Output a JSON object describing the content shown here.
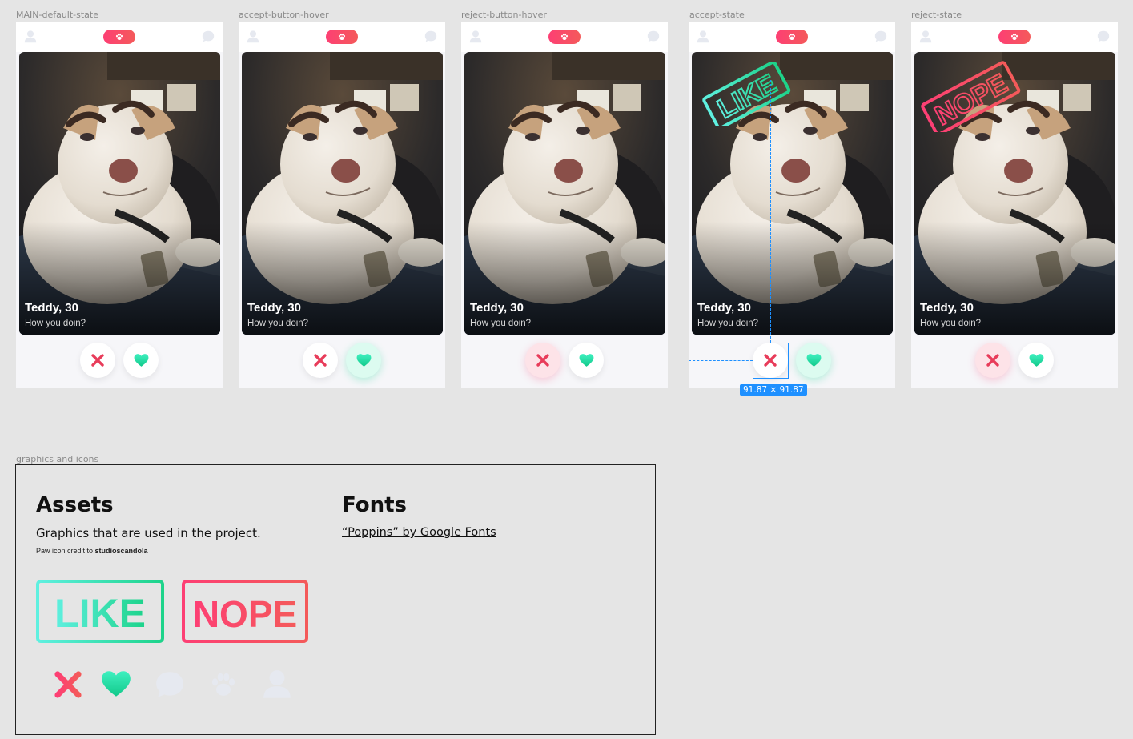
{
  "frames": [
    {
      "label": "MAIN-default-state",
      "state": "default"
    },
    {
      "label": "accept-button-hover",
      "state": "accept-hover"
    },
    {
      "label": "reject-button-hover",
      "state": "reject-hover"
    },
    {
      "label": "accept-state",
      "state": "accept"
    },
    {
      "label": "reject-state",
      "state": "reject"
    }
  ],
  "card": {
    "name": "Teddy, 30",
    "tagline": "How you doin?"
  },
  "stamps": {
    "like": "LIKE",
    "nope": "NOPE"
  },
  "measure": {
    "badge": "91.87 × 91.87"
  },
  "assets_section": {
    "label": "graphics and icons",
    "title": "Assets",
    "description": "Graphics that are used in the project.",
    "credit_prefix": "Paw icon credit to ",
    "credit_name": "studioscandola",
    "fonts_title": "Fonts",
    "fonts_link": "“Poppins” by Google Fonts"
  },
  "colors": {
    "like_start": "#5ff0e0",
    "like_end": "#1dd38a",
    "nope_start": "#fd3f74",
    "nope_end": "#f45a5a",
    "reject_icon": "#e83c5a",
    "heart": "#1ed99a",
    "muted_icon": "#e6e9f0",
    "canvas": "#e5e5e5"
  },
  "icons": [
    "close-icon",
    "heart-icon",
    "chat-icon",
    "paw-icon",
    "user-icon"
  ]
}
